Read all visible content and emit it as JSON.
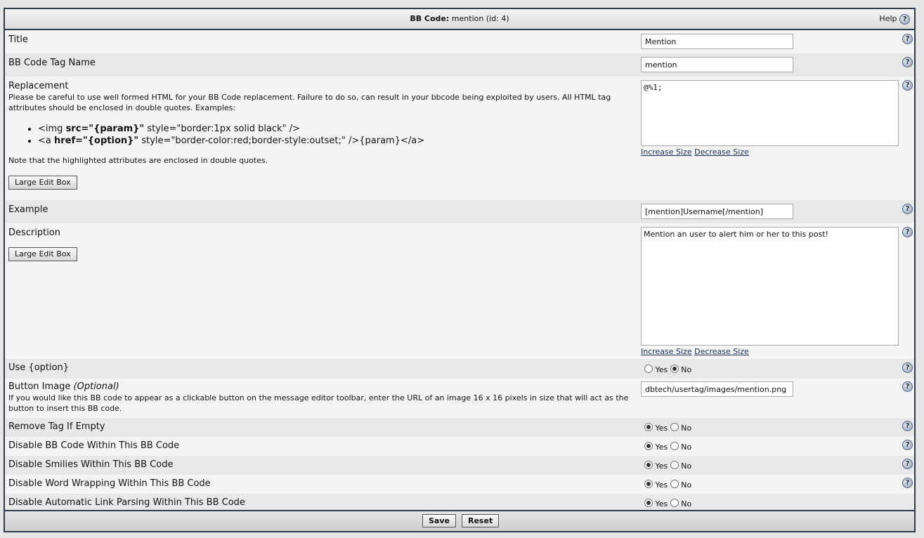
{
  "header": {
    "prefix": "BB Code:",
    "title": "mention (id: 4)",
    "help": "Help"
  },
  "rows": {
    "title": {
      "label": "Title",
      "value": "Mention"
    },
    "tag": {
      "label": "BB Code Tag Name",
      "value": "mention"
    },
    "replacement": {
      "label": "Replacement",
      "desc": "Please be careful to use well formed HTML for your BB Code replacement. Failure to do so, can result in your bbcode being exploited by users. All HTML tag attributes should be enclosed in double quotes. Examples:",
      "ex1_a": "<img ",
      "ex1_b": "src=\"{param}\"",
      "ex1_c": " style=\"border:1px solid black\" />",
      "ex2_a": "<a ",
      "ex2_b": "href=\"{option}\"",
      "ex2_c": " style=\"border-color:red;border-style:outset;\" />{param}</a>",
      "note": "Note that the highlighted attributes are enclosed in double quotes.",
      "large_edit": "Large Edit Box",
      "value": "@%1;",
      "increase": "Increase Size",
      "decrease": "Decrease Size"
    },
    "example": {
      "label": "Example",
      "value": "[mention]Username[/mention]"
    },
    "description": {
      "label": "Description",
      "large_edit": "Large Edit Box",
      "value": "Mention an user to alert him or her to this post!",
      "increase": "Increase Size",
      "decrease": "Decrease Size"
    },
    "use_option": {
      "label": "Use {option}",
      "selected": "No"
    },
    "button_image": {
      "label": "Button Image",
      "optional": "(Optional)",
      "desc": "If you would like this BB code to appear as a clickable button on the message editor toolbar, enter the URL of an image 16 x 16 pixels in size that will act as the button to insert this BB code.",
      "value": "dbtech/usertag/images/mention.png"
    },
    "remove_empty": {
      "label": "Remove Tag If Empty",
      "selected": "Yes"
    },
    "disable_bbcode": {
      "label": "Disable BB Code Within This BB Code",
      "selected": "Yes"
    },
    "disable_smilies": {
      "label": "Disable Smilies Within This BB Code",
      "selected": "Yes"
    },
    "disable_wrap": {
      "label": "Disable Word Wrapping Within This BB Code",
      "selected": "Yes"
    },
    "disable_links": {
      "label": "Disable Automatic Link Parsing Within This BB Code",
      "selected": "Yes"
    }
  },
  "radio_labels": {
    "yes": "Yes",
    "no": "No"
  },
  "icons": {
    "help": "question-icon"
  },
  "footer": {
    "save": "Save",
    "reset": "Reset"
  }
}
